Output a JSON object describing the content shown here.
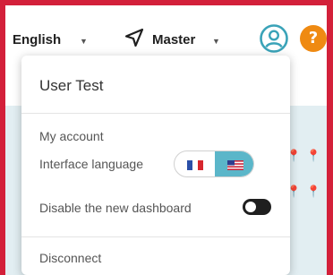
{
  "header": {
    "language_label": "English",
    "environment_label": "Master",
    "help_label": "?"
  },
  "icons": {
    "navigation": "navigation-arrow-icon",
    "user": "user-circle-icon",
    "help": "help-icon",
    "pin": "map-pin-icon"
  },
  "colors": {
    "frame": "#d3203a",
    "accent": "#5bb6c9",
    "help": "#ef8a12",
    "user_icon": "#3aa3b8"
  },
  "dropdown": {
    "user_name": "User Test",
    "my_account": "My account",
    "interface_language": "Interface language",
    "language_options": [
      "fr",
      "en"
    ],
    "active_language": "en",
    "disable_dashboard": "Disable the new dashboard",
    "disable_dashboard_enabled": true,
    "disconnect": "Disconnect"
  }
}
